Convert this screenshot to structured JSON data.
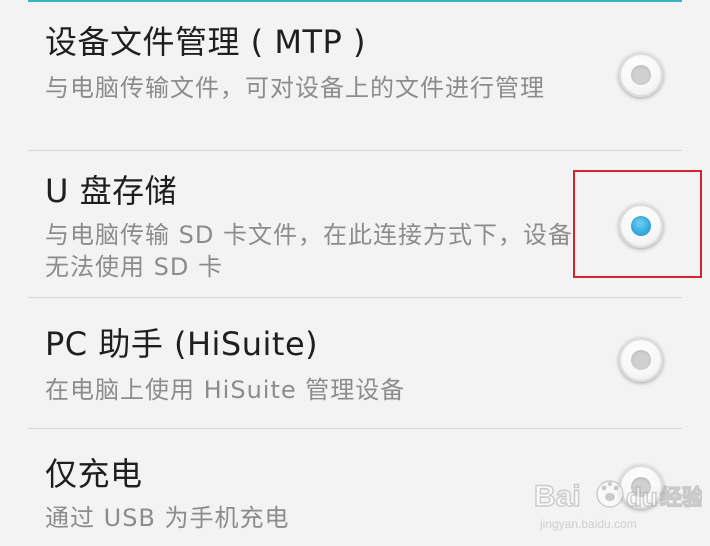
{
  "options": [
    {
      "title": "设备文件管理 ( MTP )",
      "description": "与电脑传输文件，可对设备上的文件进行管理",
      "selected": false
    },
    {
      "title": "U 盘存储",
      "description": "与电脑传输 SD 卡文件，在此连接方式下，设备无法使用 SD 卡",
      "selected": true
    },
    {
      "title": "PC 助手 (HiSuite)",
      "description": "在电脑上使用 HiSuite 管理设备",
      "selected": false
    },
    {
      "title": "仅充电",
      "description": "通过 USB 为手机充电",
      "selected": false
    }
  ],
  "colors": {
    "background": "#f3f3f3",
    "title": "#1f1f1f",
    "description": "#8c8c8c",
    "divider": "#d8d8d8",
    "selected_radio": "#36afe2",
    "highlight_box": "#d0252f",
    "top_accent": "#35b4c2"
  },
  "watermark": {
    "brand": "Bai du 经验",
    "url": "jingyan.baidu.com"
  }
}
